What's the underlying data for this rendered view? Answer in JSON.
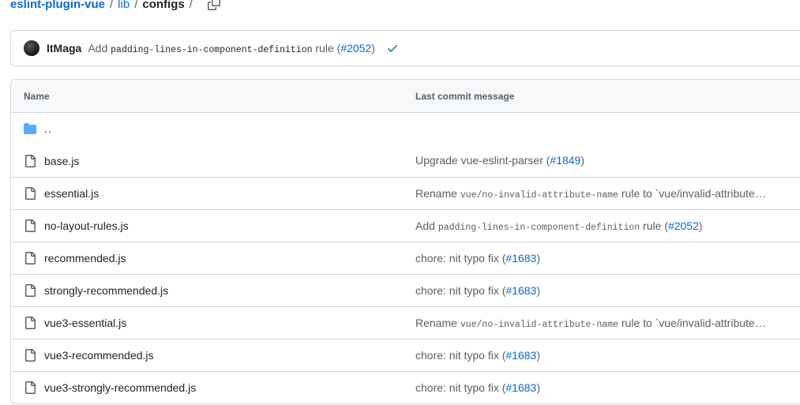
{
  "breadcrumb": {
    "repo": "eslint-plugin-vue",
    "dir": "lib",
    "current": "configs",
    "separator": "/",
    "trailing_separator": "/"
  },
  "latest_commit": {
    "author": "ItMaga",
    "message_prefix": "Add",
    "message_code": "padding-lines-in-component-definition",
    "message_suffix": "rule (",
    "pr": "#2052",
    "message_end": ")",
    "status_icon": "check-icon",
    "status_color": "#1a7f37"
  },
  "table": {
    "headers": {
      "name": "Name",
      "message": "Last commit message"
    },
    "parent": "..",
    "files": [
      {
        "name": "base.js",
        "msg_pre": "Upgrade vue-eslint-parser (",
        "msg_code": "",
        "msg_mid": "",
        "pr": "#1849",
        "msg_post": ")"
      },
      {
        "name": "essential.js",
        "msg_pre": "Rename ",
        "msg_code": "vue/no-invalid-attribute-name",
        "msg_mid": " rule to `vue/invalid-attribute…",
        "pr": "",
        "msg_post": ""
      },
      {
        "name": "no-layout-rules.js",
        "msg_pre": "Add ",
        "msg_code": "padding-lines-in-component-definition",
        "msg_mid": " rule (",
        "pr": "#2052",
        "msg_post": ")"
      },
      {
        "name": "recommended.js",
        "msg_pre": "chore: nit typo fix (",
        "msg_code": "",
        "msg_mid": "",
        "pr": "#1683",
        "msg_post": ")"
      },
      {
        "name": "strongly-recommended.js",
        "msg_pre": "chore: nit typo fix (",
        "msg_code": "",
        "msg_mid": "",
        "pr": "#1683",
        "msg_post": ")"
      },
      {
        "name": "vue3-essential.js",
        "msg_pre": "Rename ",
        "msg_code": "vue/no-invalid-attribute-name",
        "msg_mid": " rule to `vue/invalid-attribute…",
        "pr": "",
        "msg_post": ""
      },
      {
        "name": "vue3-recommended.js",
        "msg_pre": "chore: nit typo fix (",
        "msg_code": "",
        "msg_mid": "",
        "pr": "#1683",
        "msg_post": ")"
      },
      {
        "name": "vue3-strongly-recommended.js",
        "msg_pre": "chore: nit typo fix (",
        "msg_code": "",
        "msg_mid": "",
        "pr": "#1683",
        "msg_post": ")"
      }
    ]
  },
  "icons": {
    "folder": "folder-icon",
    "file": "file-icon",
    "copy": "copy-path-icon"
  },
  "colors": {
    "link": "#0969da",
    "folder": "#54aeff",
    "border": "#d0d7de",
    "header_bg": "#f6f8fa"
  }
}
